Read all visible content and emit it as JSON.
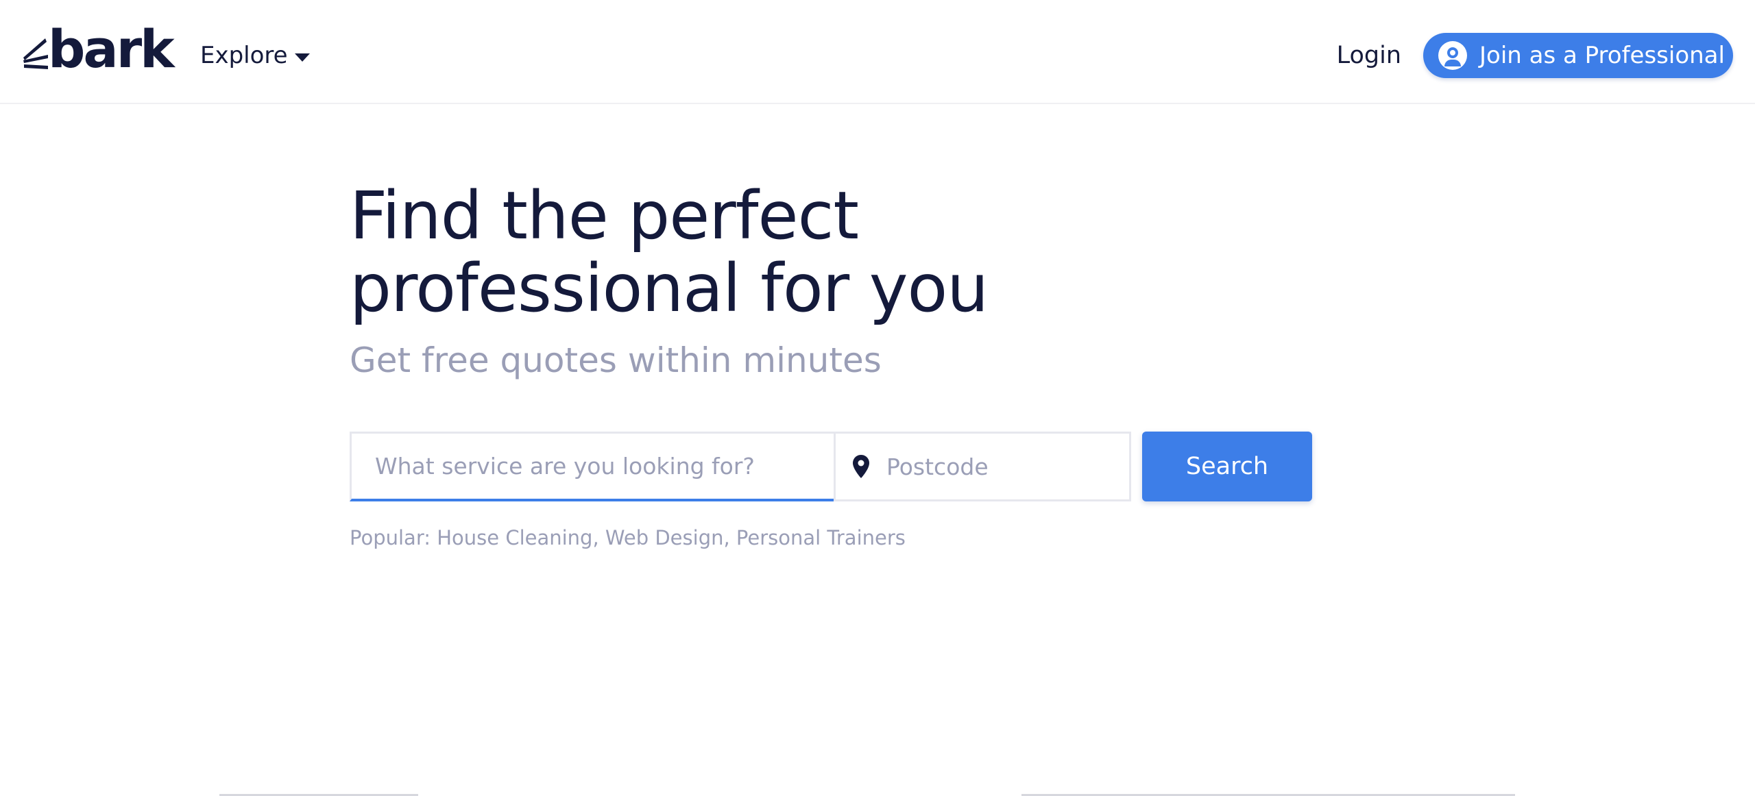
{
  "header": {
    "logo_text": "bark",
    "explore_label": "Explore",
    "login_label": "Login",
    "join_label": "Join as a Professional"
  },
  "hero": {
    "title_line1": "Find the perfect",
    "title_line2": "professional for you",
    "subtitle": "Get free quotes within minutes"
  },
  "search": {
    "service_placeholder": "What service are you looking for?",
    "service_value": "",
    "postcode_placeholder": "Postcode",
    "postcode_value": "",
    "button_label": "Search"
  },
  "popular": {
    "prefix": "Popular:",
    "items": [
      "House Cleaning",
      "Web Design",
      "Personal Trainers"
    ],
    "separator": ","
  },
  "colors": {
    "brand_blue": "#3d7ee8",
    "navy_text": "#141a3b",
    "muted_text": "#9a9eb6"
  },
  "icons": {
    "logo": "bark-logo-icon",
    "explore": "chevron-down-icon",
    "join": "user-circle-icon",
    "location": "map-pin-icon"
  }
}
